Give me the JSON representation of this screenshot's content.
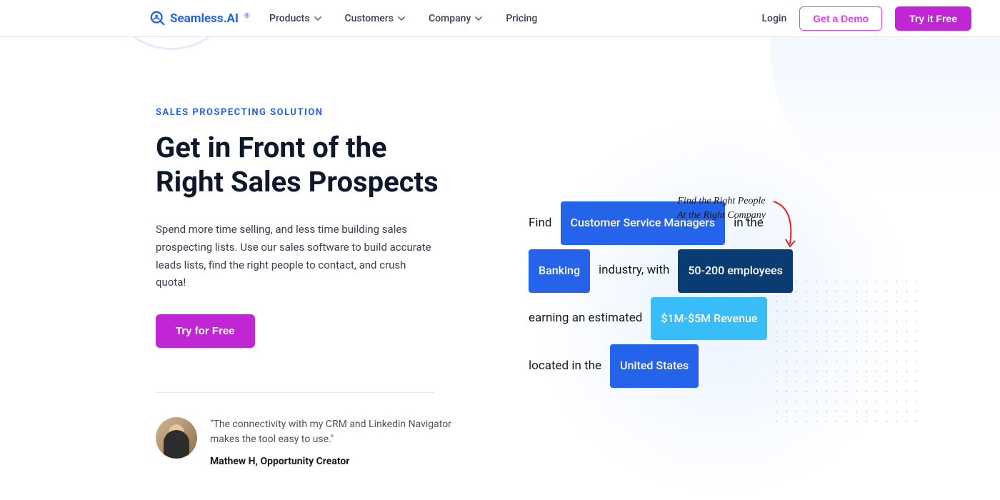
{
  "brand": {
    "name": "Seamless.AI",
    "reg": "®"
  },
  "nav": {
    "items": [
      {
        "label": "Products",
        "hasDropdown": true
      },
      {
        "label": "Customers",
        "hasDropdown": true
      },
      {
        "label": "Company",
        "hasDropdown": true
      },
      {
        "label": "Pricing",
        "hasDropdown": false
      }
    ],
    "login": "Login",
    "demo": "Get a Demo",
    "tryFree": "Try it Free"
  },
  "hero": {
    "eyebrow": "SALES PROSPECTING SOLUTION",
    "title_line1": "Get in Front of the",
    "title_line2": "Right Sales Prospects",
    "description": "Spend more time selling, and less time building sales prospecting lists. Use our sales software to build accurate leads lists, find the right people to contact, and crush quota!",
    "cta": "Try for Free"
  },
  "testimonial": {
    "quote": "\"The connectivity with my CRM and Linkedin Navigator makes the tool easy to use.\"",
    "author": "Mathew H, Opportunity Creator"
  },
  "builder": {
    "handwriting_l1": "Find the Right People",
    "handwriting_l2": "At the Right Company",
    "find": "Find",
    "role": "Customer Service Managers",
    "in_the": "in the",
    "industry": "Banking",
    "industry_with": "industry, with",
    "employees": "50-200 employees",
    "earning": "earning an estimated",
    "revenue": "$1M-$5M Revenue",
    "located": "located in the",
    "country": "United States"
  }
}
